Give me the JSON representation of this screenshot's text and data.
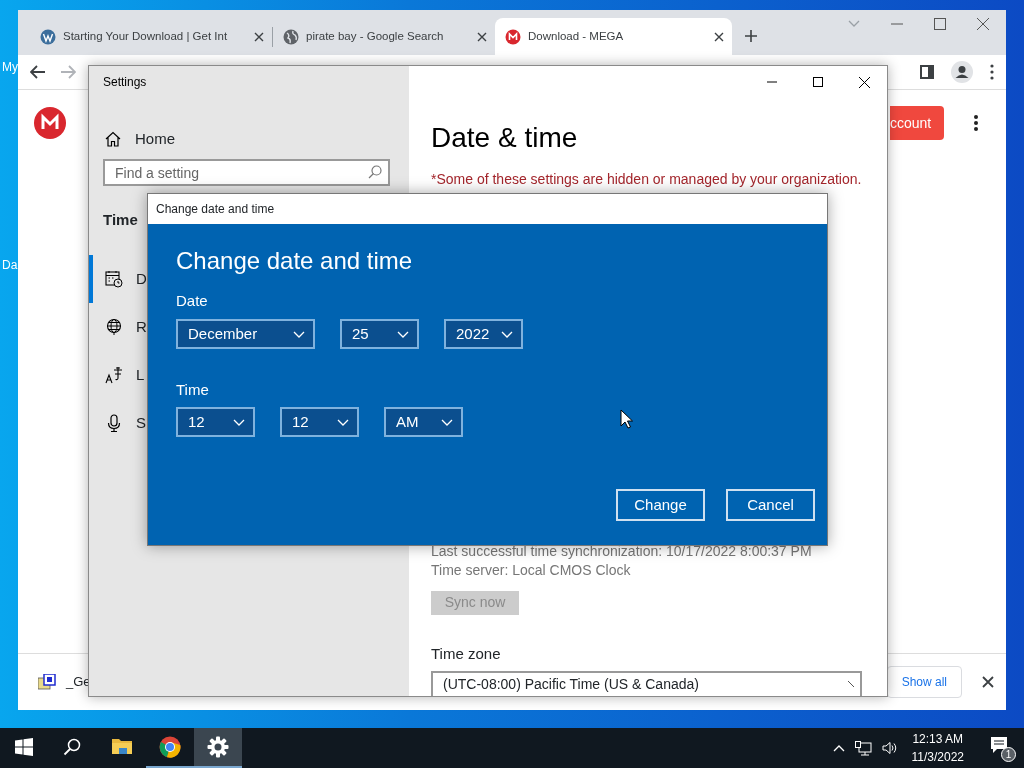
{
  "desktop": {
    "icon_labels": [
      "My",
      "Da"
    ]
  },
  "browser": {
    "tabs": [
      {
        "title": "Starting Your Download | Get Int",
        "kind": "wordpress",
        "selected": false
      },
      {
        "title": "pirate bay - Google Search",
        "kind": "globe",
        "selected": false
      },
      {
        "title": "Download - MEGA",
        "kind": "mega",
        "selected": true
      }
    ],
    "account_button": "ccount",
    "download_bar": {
      "item": "_Ge",
      "show_all": "Show all"
    }
  },
  "settings": {
    "title": "Settings",
    "home": "Home",
    "search_placeholder": "Find a setting",
    "section": "Time",
    "nav": [
      {
        "label": "D",
        "kind": "calendar",
        "selected": true
      },
      {
        "label": "R",
        "kind": "globe",
        "selected": false
      },
      {
        "label": "L",
        "kind": "language",
        "selected": false
      },
      {
        "label": "S",
        "kind": "microphone",
        "selected": false
      }
    ],
    "heading": "Date & time",
    "notice": "*Some of these settings are hidden or managed by your organization.",
    "sync_info": [
      "Last successful time synchronization: 10/17/2022 8:00:37 PM",
      "Time server: Local CMOS Clock"
    ],
    "sync_button": {
      "label": "Sync now",
      "disabled": true
    },
    "time_zone_label": "Time zone",
    "time_zone": "(UTC-08:00) Pacific Time (US & Canada)"
  },
  "dialog": {
    "title": "Change date and time",
    "heading": "Change date and time",
    "date_label": "Date",
    "date_fields": [
      "December",
      "25",
      "2022"
    ],
    "time_label": "Time",
    "time_fields": [
      "12",
      "12",
      "AM"
    ],
    "buttons": [
      "Change",
      "Cancel"
    ]
  },
  "taskbar": {
    "apps": [
      {
        "kind": "folder",
        "running": false,
        "active": false
      },
      {
        "kind": "chrome",
        "running": true,
        "active": false
      },
      {
        "kind": "settings",
        "running": true,
        "active": true
      }
    ],
    "clock_time": "12:13 AM",
    "clock_date": "11/3/2022",
    "notification_count": "1"
  }
}
